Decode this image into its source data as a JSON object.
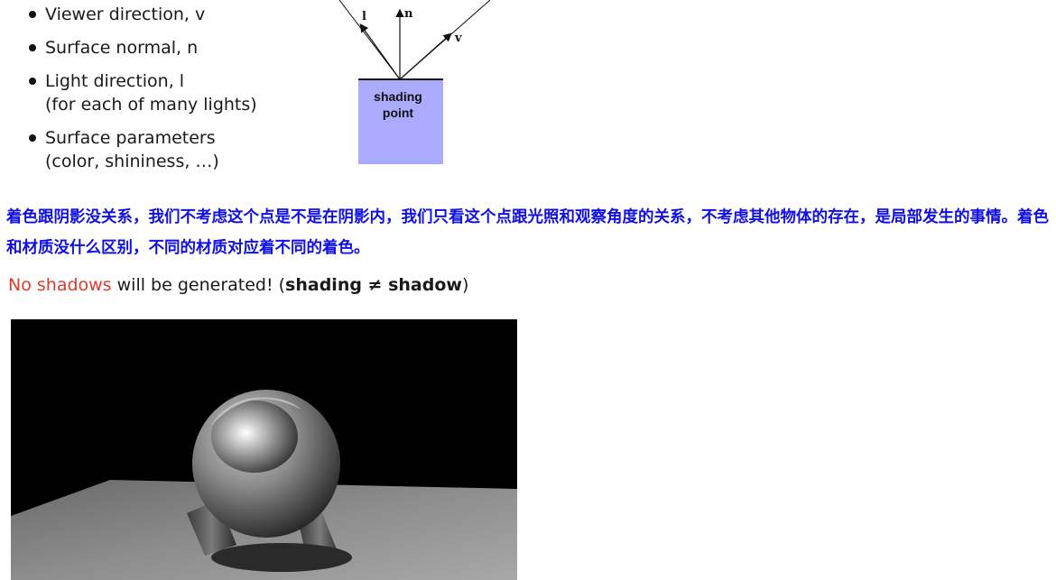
{
  "inputs": [
    {
      "label": "Viewer direction, v",
      "sub": ""
    },
    {
      "label": "Surface normal, n",
      "sub": ""
    },
    {
      "label": "Light direction, l",
      "sub": "(for each of many lights)"
    },
    {
      "label": "Surface parameters",
      "sub": "(color, shininess, …)"
    }
  ],
  "diagram": {
    "light_label": "l",
    "normal_label": "n",
    "viewer_label": "v",
    "point_label_line1": "shading",
    "point_label_line2": "point",
    "box_color": "#aaaaff"
  },
  "note_cn": "着色跟阴影没关系，我们不考虑这个点是不是在阴影内，我们只看这个点跟光照和观察角度的关系，不考虑其他物体的存在，是局部发生的事情。着色和材质没什么区别，不同的材质对应着不同的着色。",
  "shadow_line": {
    "red": "No shadows",
    "rest": " will be generated! (",
    "bold": "shading ≠ shadow",
    "end": ")"
  },
  "colors": {
    "note": "#1010e6",
    "red": "#e03a2c"
  }
}
